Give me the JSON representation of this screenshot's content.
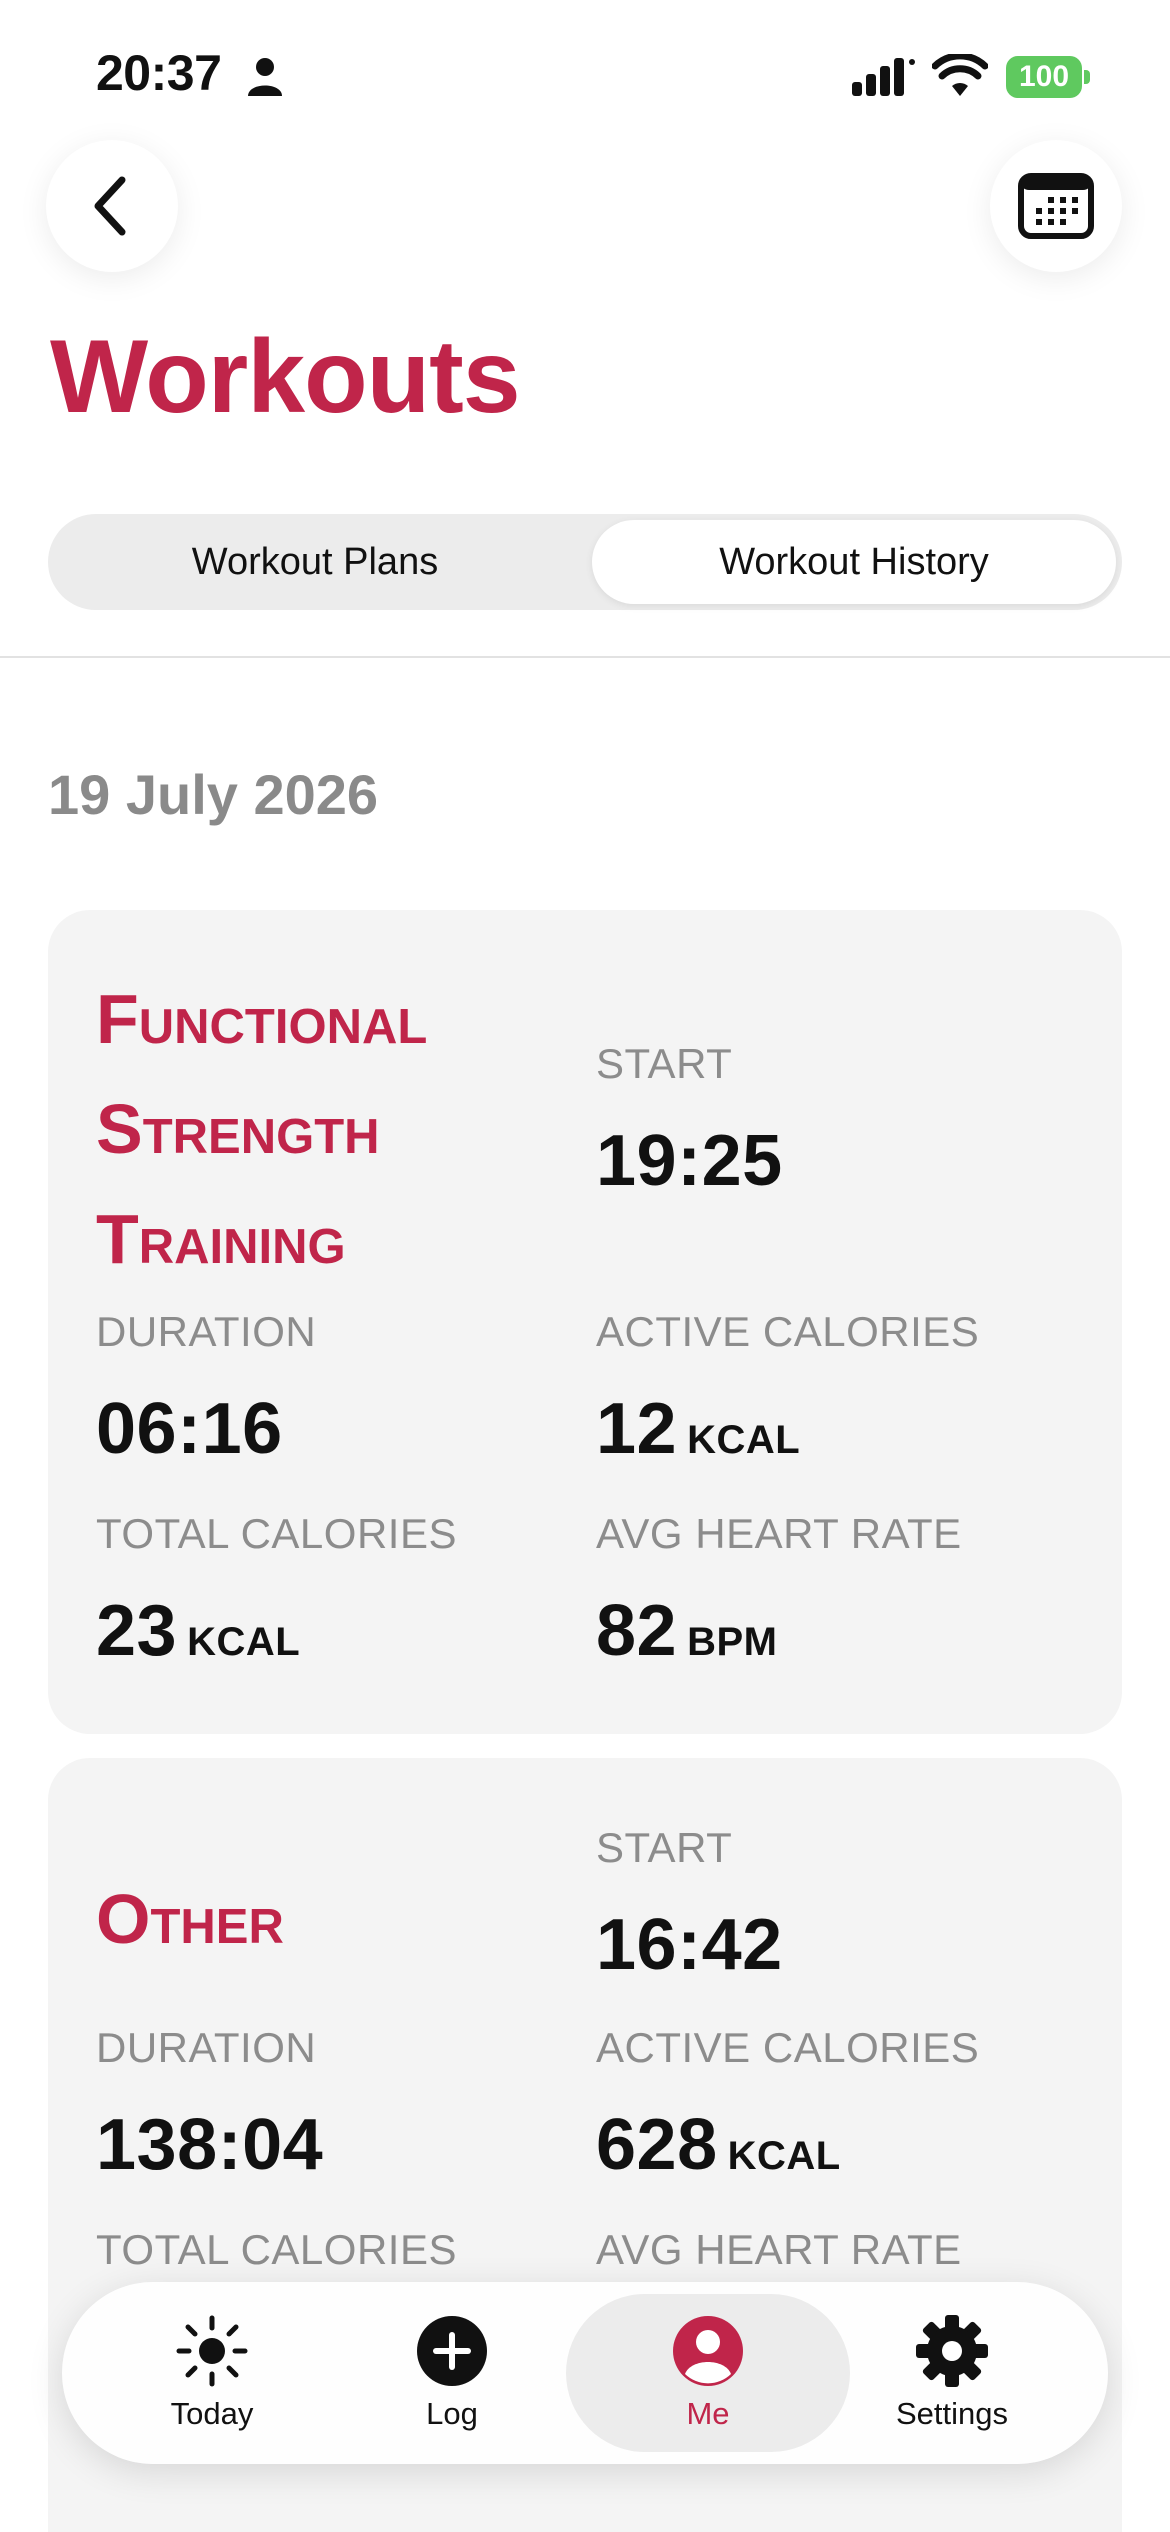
{
  "status_bar": {
    "time": "20:37",
    "battery": "100"
  },
  "header": {
    "title": "Workouts"
  },
  "segments": {
    "plans_label": "Workout Plans",
    "history_label": "Workout History",
    "selected": "Workout History"
  },
  "date_heading": "19 July 2026",
  "workouts": [
    {
      "title": "Functional Strength Training",
      "start_label": "START",
      "start_value": "19:25",
      "duration_label": "DURATION",
      "duration_value": "06:16",
      "active_cal_label": "ACTIVE CALORIES",
      "active_cal_value": "12",
      "active_cal_unit": "KCAL",
      "total_cal_label": "TOTAL CALORIES",
      "total_cal_value": "23",
      "total_cal_unit": "KCAL",
      "heart_rate_label": "AVG HEART RATE",
      "heart_rate_value": "82",
      "heart_rate_unit": "BPM"
    },
    {
      "title": "Other",
      "start_label": "START",
      "start_value": "16:42",
      "duration_label": "DURATION",
      "duration_value": "138:04",
      "active_cal_label": "ACTIVE CALORIES",
      "active_cal_value": "628",
      "active_cal_unit": "KCAL",
      "total_cal_label": "TOTAL CALORIES",
      "heart_rate_label": "AVG HEART RATE"
    }
  ],
  "tab_bar": {
    "items": [
      {
        "label": "Today",
        "icon": "sun-icon"
      },
      {
        "label": "Log",
        "icon": "plus-circle-icon"
      },
      {
        "label": "Me",
        "icon": "person-circle-icon",
        "active": true
      },
      {
        "label": "Settings",
        "icon": "gear-icon"
      }
    ]
  },
  "colors": {
    "accent": "#c0254a",
    "battery": "#5fc95f",
    "card_bg": "#f4f4f4",
    "muted_text": "#8c8c8c"
  }
}
